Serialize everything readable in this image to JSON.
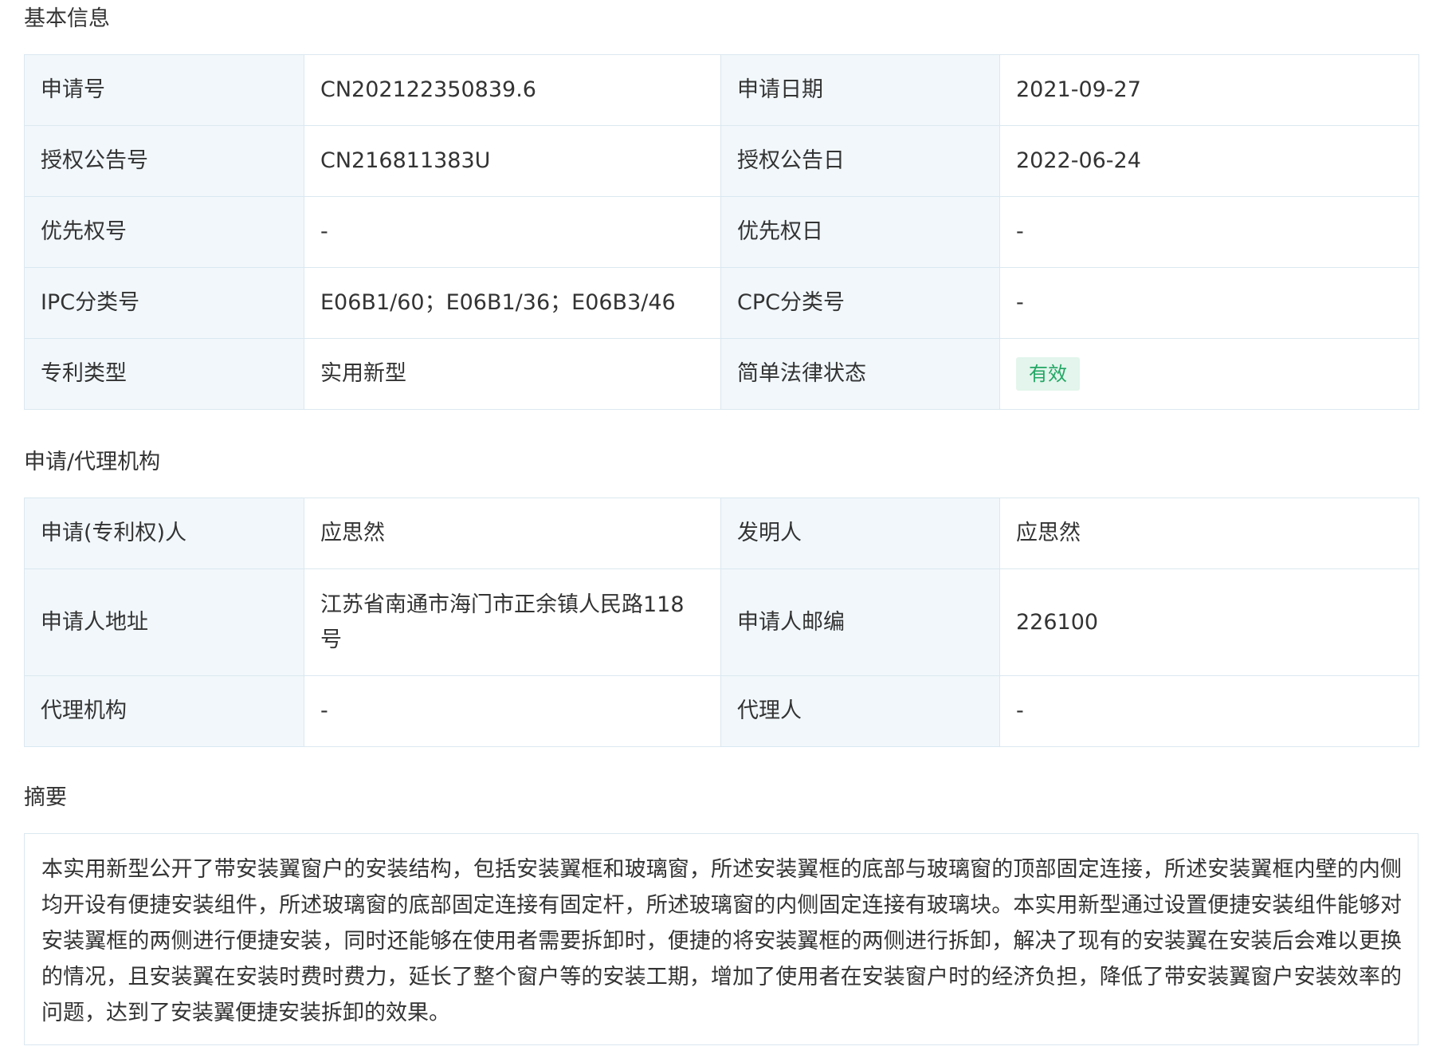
{
  "sections": {
    "basic_title": "基本信息",
    "agency_title": "申请/代理机构",
    "abstract_title": "摘要"
  },
  "basic": {
    "app_no_label": "申请号",
    "app_no": "CN202122350839.6",
    "app_date_label": "申请日期",
    "app_date": "2021-09-27",
    "grant_no_label": "授权公告号",
    "grant_no": "CN216811383U",
    "grant_date_label": "授权公告日",
    "grant_date": "2022-06-24",
    "priority_no_label": "优先权号",
    "priority_no": "-",
    "priority_date_label": "优先权日",
    "priority_date": "-",
    "ipc_label": "IPC分类号",
    "ipc": "E06B1/60；E06B1/36；E06B3/46",
    "cpc_label": "CPC分类号",
    "cpc": "-",
    "type_label": "专利类型",
    "type": "实用新型",
    "legal_status_label": "简单法律状态",
    "legal_status": "有效",
    "legal_status_color": "#22a664"
  },
  "agency": {
    "applicant_label": "申请(专利权)人",
    "applicant": "应思然",
    "inventor_label": "发明人",
    "inventor": "应思然",
    "address_label": "申请人地址",
    "address": "江苏省南通市海门市正余镇人民路118号",
    "postcode_label": "申请人邮编",
    "postcode": "226100",
    "agency_label": "代理机构",
    "agency": "-",
    "agent_label": "代理人",
    "agent": "-"
  },
  "abstract": {
    "text": "本实用新型公开了带安装翼窗户的安装结构，包括安装翼框和玻璃窗，所述安装翼框的底部与玻璃窗的顶部固定连接，所述安装翼框内壁的内侧均开设有便捷安装组件，所述玻璃窗的底部固定连接有固定杆，所述玻璃窗的内侧固定连接有玻璃块。本实用新型通过设置便捷安装组件能够对安装翼框的两侧进行便捷安装，同时还能够在使用者需要拆卸时，便捷的将安装翼框的两侧进行拆卸，解决了现有的安装翼在安装后会难以更换的情况，且安装翼在安装时费时费力，延长了整个窗户等的安装工期，增加了使用者在安装窗户时的经济负担，降低了带安装翼窗户安装效率的问题，达到了安装翼便捷安装拆卸的效果。"
  }
}
